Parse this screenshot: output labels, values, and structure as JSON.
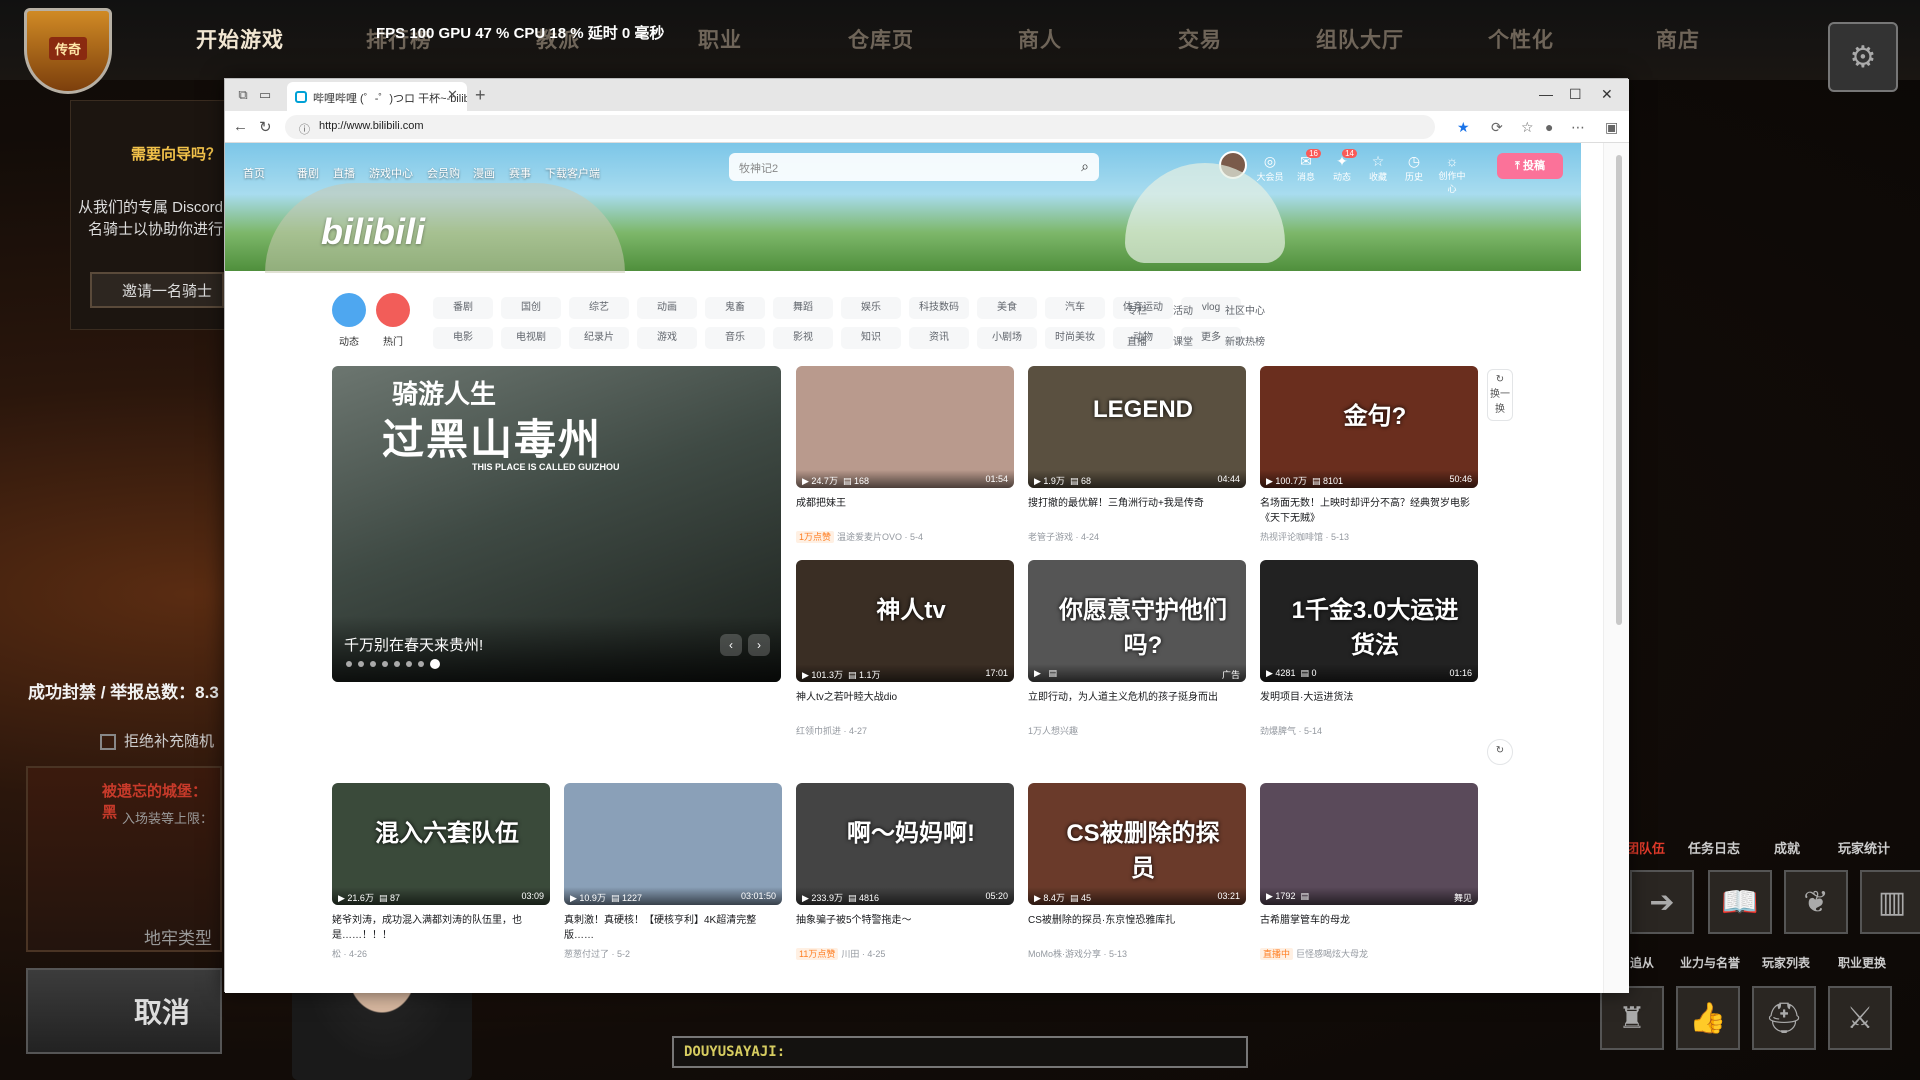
{
  "game": {
    "crest_label": "传奇",
    "nav": [
      "开始游戏",
      "排行榜",
      "教派",
      "职业",
      "仓库页",
      "商人",
      "交易",
      "组队大厅",
      "个性化",
      "商店"
    ],
    "fps_text": "FPS 100  GPU 47 %  CPU 18 %  延时 0 毫秒",
    "need_guide": "需要向导吗？",
    "discord_text": "从我们的专属 Discord 名骑士以协助你进行",
    "invite": "邀请一名骑士",
    "banned": "成功封禁 / 举报总数：8.3",
    "refuse": "拒绝补充随机",
    "dungeon_title": "被遗忘的城堡：黑",
    "dungeon_sub": "入场装等上限：",
    "dungeon_type": "地牢类型",
    "cancel": "取消",
    "right_tabs": [
      "团队伍",
      "任务日志",
      "成就",
      "玩家统计"
    ],
    "right_labels": [
      "追从",
      "业力与名誉",
      "玩家列表",
      "职业更换"
    ],
    "chat": "DOUYUSAYAJI:"
  },
  "browser": {
    "tab_title": "哔哩哔哩 (゜-゜)つロ 干杯~-bilibili",
    "url": "http://www.bilibili.com"
  },
  "bili": {
    "logo": "bilibili",
    "nav": [
      "首页",
      "番剧",
      "直播",
      "游戏中心",
      "会员购",
      "漫画",
      "赛事",
      "下载客户端"
    ],
    "search_placeholder": "牧神记2",
    "icons": [
      {
        "label": "大会员",
        "badge": ""
      },
      {
        "label": "消息",
        "badge": "16"
      },
      {
        "label": "动态",
        "badge": "14"
      },
      {
        "label": "收藏",
        "badge": ""
      },
      {
        "label": "历史",
        "badge": ""
      },
      {
        "label": "创作中心",
        "badge": ""
      }
    ],
    "upload": "投稿",
    "channels": [
      {
        "label": "动态",
        "color": "#4ea7f0"
      },
      {
        "label": "热门",
        "color": "#f25d59"
      }
    ],
    "cats_row1": [
      "番剧",
      "国创",
      "综艺",
      "动画",
      "鬼畜",
      "舞蹈",
      "娱乐",
      "科技数码",
      "美食",
      "汽车",
      "体育运动",
      "vlog"
    ],
    "cats_row2": [
      "电影",
      "电视剧",
      "纪录片",
      "游戏",
      "音乐",
      "影视",
      "知识",
      "资讯",
      "小剧场",
      "时尚美妆",
      "动物",
      "更多"
    ],
    "side_links_1": [
      "专栏",
      "活动",
      "社区中心"
    ],
    "side_links_2": [
      "直播",
      "课堂",
      "新歌热榜"
    ],
    "carousel": {
      "art_title": "过黑山毒州",
      "art_sub": "THIS PLACE IS CALLED GUIZHOU",
      "top": "骑游人生",
      "caption": "千万别在春天来贵州!"
    },
    "cards": [
      {
        "views": "24.7万",
        "danmaku": "168",
        "dur": "01:54",
        "title": "成都把妹王",
        "badge": "1万点赞",
        "meta": "温途爱麦片OVO · 5-4",
        "color": "#b99a8d",
        "art": ""
      },
      {
        "views": "1.9万",
        "danmaku": "68",
        "dur": "04:44",
        "title": "搜打撤的最优解！三角洲行动+我是传奇",
        "badge": "",
        "meta": "老管子游戏 · 4-24",
        "color": "#5a5040",
        "art": "LEGEND"
      },
      {
        "views": "100.7万",
        "danmaku": "8101",
        "dur": "50:46",
        "title": "名场面无数！上映时却评分不高？经典贺岁电影《天下无贼》",
        "badge": "",
        "meta": "热视评论咖啡馆 · 5-13",
        "color": "#6a2e1e",
        "art": "金句?"
      },
      {
        "views": "101.3万",
        "danmaku": "1.1万",
        "dur": "17:01",
        "title": "神人tv之若叶睦大战dio",
        "badge": "",
        "meta": "红领巾抓进 · 4-27",
        "color": "#3a2e24",
        "art": "神人tv"
      },
      {
        "views": "",
        "danmaku": "",
        "dur": "广告",
        "title": "立即行动，为人道主义危机的孩子挺身而出",
        "badge": "",
        "meta": "1万人想兴趣",
        "color": "#555",
        "art": "你愿意守护他们吗?"
      },
      {
        "views": "4281",
        "danmaku": "0",
        "dur": "01:16",
        "title": "发明项目·大运进货法",
        "badge": "",
        "meta": "劲爆脾气 · 5-14",
        "color": "#222",
        "art": "1千金3.0大运进货法"
      },
      {
        "views": "21.6万",
        "danmaku": "87",
        "dur": "03:09",
        "title": "姥爷刘涛，成功混入满都刘涛的队伍里，也是……！！！",
        "badge": "",
        "meta": "松 · 4-26",
        "color": "#3a4a3a",
        "art": "混入六套队伍"
      },
      {
        "views": "10.9万",
        "danmaku": "1227",
        "dur": "03:01:50",
        "title": "真刺激！真硬核！【硬核亨利】4K超清完整版……",
        "badge": "",
        "meta": "葱葱付过了 · 5-2",
        "color": "#8aa0b8",
        "art": ""
      },
      {
        "views": "233.9万",
        "danmaku": "4816",
        "dur": "05:20",
        "title": "抽象骗子被5个特警拖走～",
        "badge": "11万点赞",
        "meta": "川田 · 4-25",
        "color": "#444",
        "art": "啊～妈妈啊!"
      },
      {
        "views": "8.4万",
        "danmaku": "45",
        "dur": "03:21",
        "title": "CS被删除的探员·东京惶恐雅库扎",
        "badge": "",
        "meta": "MoMo株·游戏分享 · 5-13",
        "color": "#6a3a2a",
        "art": "CS被删除的探员"
      },
      {
        "views": "1792",
        "danmaku": "",
        "dur": "舞见",
        "title": "古希腊掌管车的母龙",
        "badge": "直播中",
        "meta": "巨怪感喝炫大母龙",
        "color": "#5a4a5a",
        "art": ""
      }
    ],
    "refresh_label": "换一换"
  }
}
